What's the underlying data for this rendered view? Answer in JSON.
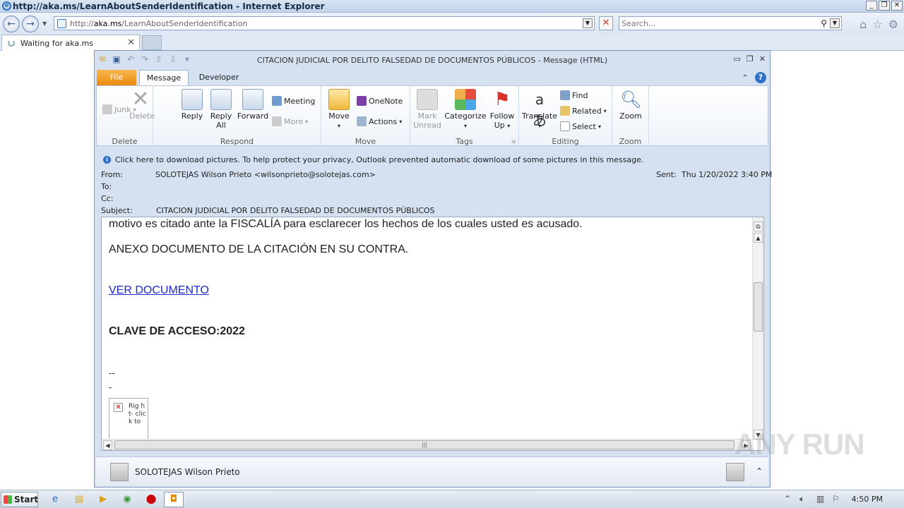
{
  "browser": {
    "title": "http://aka.ms/LearnAboutSenderIdentification - Internet Explorer",
    "url_prefix": "http://",
    "url_host": "aka.ms",
    "url_path": "/LearnAboutSenderIdentification",
    "search_placeholder": "Search...",
    "tab_label": "Waiting for aka.ms"
  },
  "outlook": {
    "window_title": "CITACION JUDICIAL POR DELITO FALSEDAD DE DOCUMENTOS PÚBLICOS  -  Message (HTML)",
    "tabs": {
      "file": "File",
      "message": "Message",
      "developer": "Developer"
    },
    "ribbon": {
      "delete_group": {
        "label": "Delete",
        "junk": "Junk",
        "delete": "Delete"
      },
      "respond_group": {
        "label": "Respond",
        "reply": "Reply",
        "reply_all_1": "Reply",
        "reply_all_2": "All",
        "forward": "Forward",
        "meeting": "Meeting",
        "more": "More"
      },
      "move_group": {
        "label": "Move",
        "move": "Move",
        "onenote": "OneNote",
        "actions": "Actions"
      },
      "tags_group": {
        "label": "Tags",
        "mark_unread_1": "Mark",
        "mark_unread_2": "Unread",
        "categorize": "Categorize",
        "follow_up_1": "Follow",
        "follow_up_2": "Up"
      },
      "editing_group": {
        "label": "Editing",
        "translate": "Translate",
        "find": "Find",
        "related": "Related",
        "select": "Select"
      },
      "zoom_group": {
        "label": "Zoom",
        "zoom": "Zoom"
      }
    },
    "infobar": "Click here to download pictures. To help protect your privacy, Outlook prevented automatic download of some pictures in this message.",
    "headers": {
      "from_label": "From:",
      "from_value": "SOLOTEJAS Wilson Prieto <wilsonprieto@solotejas.com>",
      "to_label": "To:",
      "cc_label": "Cc:",
      "subject_label": "Subject:",
      "subject_value": "CITACION JUDICIAL POR DELITO FALSEDAD DE DOCUMENTOS PÚBLICOS",
      "sent_label": "Sent:",
      "sent_value": "Thu 1/20/2022 3:40 PM"
    },
    "body": {
      "line1": "motivo es citado ante la FISCALÍA para esclarecer los hechos de los cuales usted es acusado.",
      "line2": "ANEXO DOCUMENTO DE LA CITACIÓN EN SU CONTRA.",
      "link": "VER DOCUMENTO ",
      "access_key": "CLAVE DE ACCESO:2022",
      "sig1": "--",
      "sig2": "-",
      "image_alt": "Rig ht- clic k to"
    },
    "people_pane_name": "SOLOTEJAS Wilson Prieto"
  },
  "watermark": "ANY RUN",
  "taskbar": {
    "start": "Start",
    "clock": "4:50 PM"
  }
}
